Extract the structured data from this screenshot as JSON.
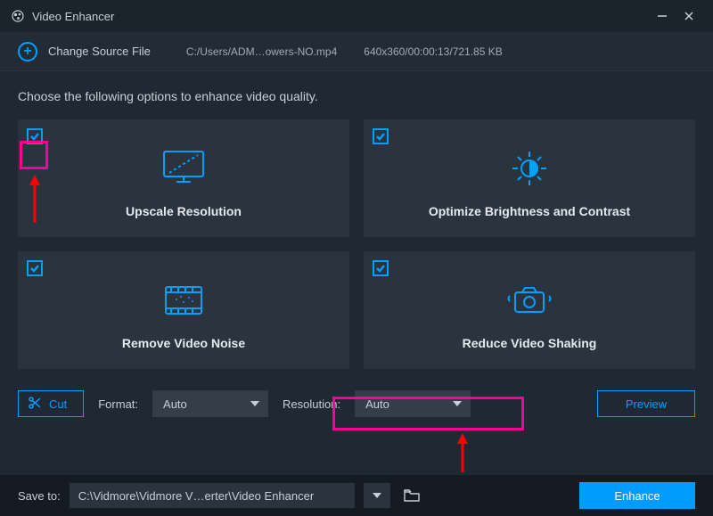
{
  "window": {
    "title": "Video Enhancer"
  },
  "source": {
    "change_label": "Change Source File",
    "path": "C:/Users/ADM…owers-NO.mp4",
    "meta": "640x360/00:00:13/721.85 KB"
  },
  "instruction": "Choose the following options to enhance video quality.",
  "cards": [
    {
      "label": "Upscale Resolution",
      "checked": true
    },
    {
      "label": "Optimize Brightness and Contrast",
      "checked": true
    },
    {
      "label": "Remove Video Noise",
      "checked": true
    },
    {
      "label": "Reduce Video Shaking",
      "checked": true
    }
  ],
  "controls": {
    "cut_label": "Cut",
    "format_label": "Format:",
    "format_value": "Auto",
    "resolution_label": "Resolution:",
    "resolution_value": "Auto",
    "preview_label": "Preview"
  },
  "bottom": {
    "save_label": "Save to:",
    "save_path": "C:\\Vidmore\\Vidmore V…erter\\Video Enhancer",
    "enhance_label": "Enhance"
  }
}
